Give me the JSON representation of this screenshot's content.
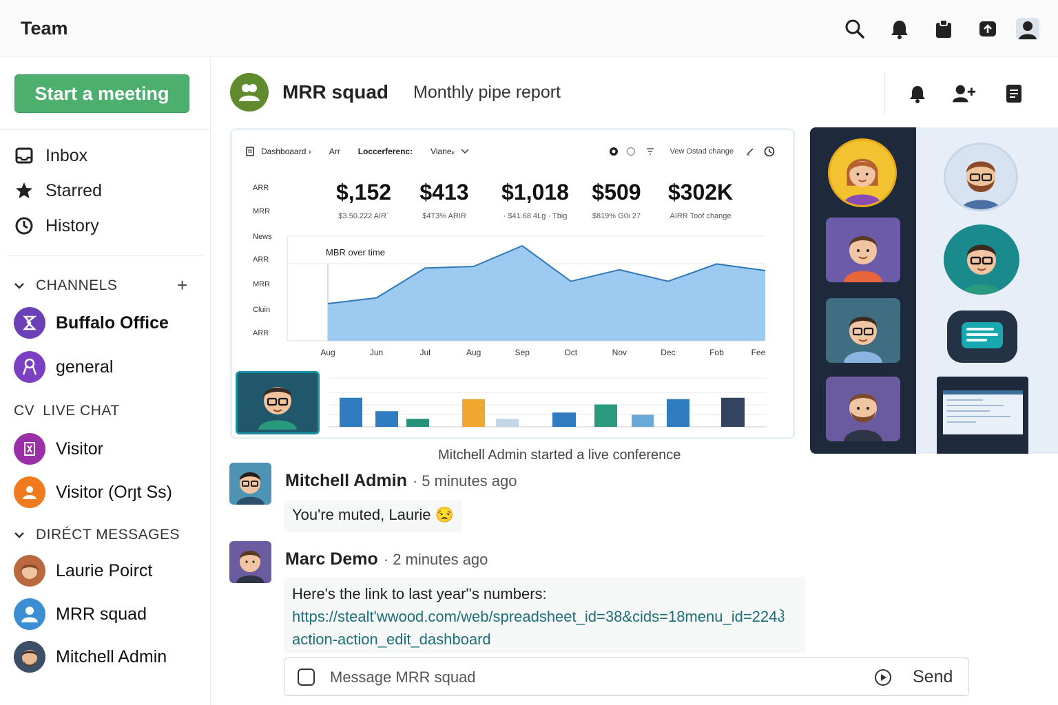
{
  "topbar": {
    "title": "Team",
    "icons": [
      "search-icon",
      "bell-icon",
      "clipboard-icon",
      "share-screen-icon",
      "user-avatar-icon"
    ]
  },
  "sidebar": {
    "start_meeting": "Start a meeting",
    "nav": [
      {
        "label": "Inbox",
        "icon": "inbox-icon"
      },
      {
        "label": "Starred",
        "icon": "star-icon"
      },
      {
        "label": "History",
        "icon": "clock-icon"
      }
    ],
    "channels_header": "CHANNELS",
    "channels": [
      {
        "label": "Buffalo Office",
        "color": "#6b3fb5"
      },
      {
        "label": "general",
        "color": "#7b3fc4"
      }
    ],
    "live_chat_prefix": "CV",
    "live_chat_header": "LIVE CHAT",
    "live_chat": [
      {
        "label": "Visitor",
        "color": "#9b2fa8"
      },
      {
        "label": "Visitor (Orȷt Ss)",
        "color": "#f07b1f"
      }
    ],
    "dm_header": "DIRÉCT MESSAGES",
    "direct_messages": [
      {
        "label": "Laurie Poirct"
      },
      {
        "label": "MRR squad"
      },
      {
        "label": "Mitchell Admin"
      }
    ]
  },
  "header": {
    "group_name": "MRR squad",
    "description": "Monthly pipe report",
    "actions": [
      "notification-icon",
      "add-user-icon",
      "document-icon"
    ]
  },
  "shared_screen": {
    "toolbar": {
      "breadcrumb": "Dashboaard ›",
      "tab1": "Arr",
      "tab2": "Loccerferenc:",
      "tab3": "Vianeₖ",
      "right_text": "Vew Ostad change"
    },
    "kpi_labels": [
      "ARR",
      "MRR"
    ],
    "kpis": [
      {
        "value": "$,152",
        "sub": "$3.50.222 AIR˙"
      },
      {
        "value": "$413",
        "sub": "$4T3% ARIR"
      },
      {
        "value": "$1,018",
        "sub": "· $41.68 4Lg · Tbig"
      },
      {
        "value": "$509",
        "sub": "$819% G0ı 27"
      },
      {
        "value": "$302K",
        "sub": "AIRR Toof change"
      }
    ],
    "side_labels": [
      "News",
      "ARR",
      "MRR",
      "Cluin",
      "ARR"
    ]
  },
  "chart_data": [
    {
      "type": "area",
      "title": "MBR over time",
      "categories": [
        "Aug",
        "Jun",
        "Jul",
        "Aug",
        "Sep",
        "Oct",
        "Nov",
        "Dec",
        "Fob",
        "Fee"
      ],
      "values": [
        45,
        52,
        88,
        90,
        115,
        72,
        86,
        72,
        93,
        85
      ],
      "ylim": [
        0,
        130
      ],
      "color": "#9ccaf0",
      "line_color": "#2f78b8"
    },
    {
      "type": "bar",
      "categories": [
        "1",
        "2",
        "3",
        "4",
        "5",
        "6",
        "7",
        "8",
        "9",
        "10"
      ],
      "values": [
        65,
        35,
        18,
        62,
        18,
        32,
        50,
        27,
        62,
        65
      ],
      "colors": [
        "#2f7cc1",
        "#2f7cc1",
        "#27917a",
        "#f0a830",
        "#c5d6e6",
        "#2f7cc1",
        "#2a9a7e",
        "#6aa8da",
        "#2f7cc1",
        "#33455e"
      ],
      "ylim": [
        0,
        100
      ]
    }
  ],
  "conversation": {
    "notice": "Mitchell Admin started a live conference",
    "messages": [
      {
        "author": "Mitchell Admin",
        "time": "· 5 minutes ago",
        "text": "You're muted, Laurie 😒"
      },
      {
        "author": "Marc Demo",
        "time": "· 2 minutes ago",
        "text": "Here's the link to last year''s numbers:",
        "link1": "https://stealt'wwood.com/web/spreadsheet_id=38&cids=18menu_id=224ჰ",
        "link2": "action-action_edit_dashboard"
      }
    ]
  },
  "composer": {
    "placeholder": "Message MRR squad",
    "send": "Send"
  }
}
